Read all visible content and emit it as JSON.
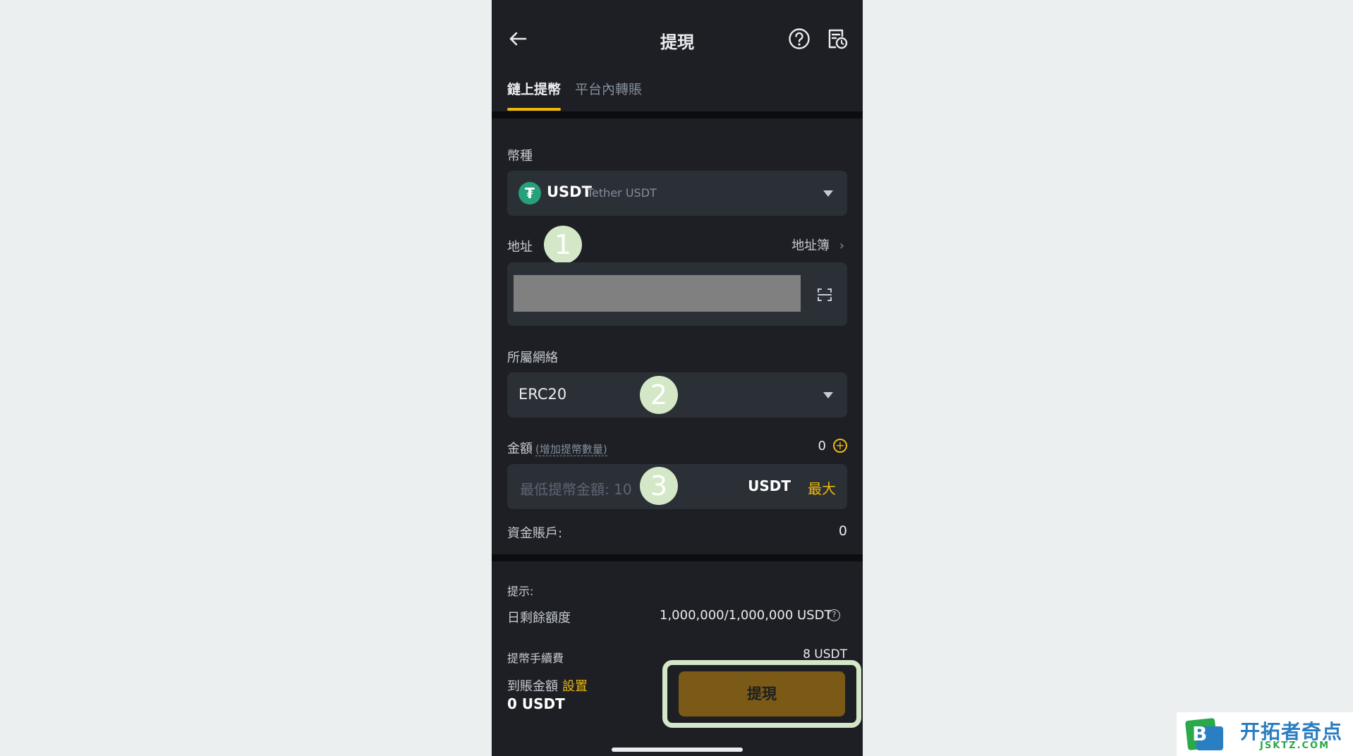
{
  "header": {
    "title": "提現"
  },
  "tabs": [
    {
      "label": "鏈上提幣",
      "active": true
    },
    {
      "label": "平台內轉賬",
      "active": false
    }
  ],
  "coin": {
    "label": "幣種",
    "icon_glyph": "₮",
    "symbol": "USDT",
    "name": "Tether USDT"
  },
  "address": {
    "label": "地址",
    "book_label": "地址簿",
    "book_chevron": "›"
  },
  "network": {
    "label": "所屬網絡",
    "value": "ERC20"
  },
  "amount": {
    "label": "金額",
    "hint": "(增加提幣數量)",
    "count": "0",
    "plus_glyph": "+",
    "placeholder": "最低提幣金額: 10",
    "unit": "USDT",
    "max_label": "最大"
  },
  "funding": {
    "label": "資金賬戶:",
    "value": "0"
  },
  "tips": {
    "title": "提示:",
    "daily_label": "日剩餘額度",
    "daily_value": "1,000,000/1,000,000 USDT",
    "info_glyph": "?",
    "fee_label": "提幣手續費",
    "fee_value": "8 USDT"
  },
  "received": {
    "label": "到賬金額",
    "settings_label": "設置",
    "value": "0 USDT"
  },
  "submit": {
    "label": "提現"
  },
  "annotations": {
    "step1": "1",
    "step2": "2",
    "step3": "3"
  },
  "watermark": {
    "logo_letter": "B",
    "title": "开拓者奇点",
    "subtitle": "JSKTZ.COM"
  },
  "colors": {
    "background": "#1d1f24",
    "field": "#2b2f36",
    "accent": "#f0b90b",
    "tether_green": "#26a17b",
    "annotation_green": "#d4e8c7"
  },
  "icons": {
    "back": "arrow-left-icon",
    "help": "question-circle-icon",
    "history": "history-document-icon",
    "scan": "scan-icon",
    "dropdown": "caret-down-icon"
  }
}
